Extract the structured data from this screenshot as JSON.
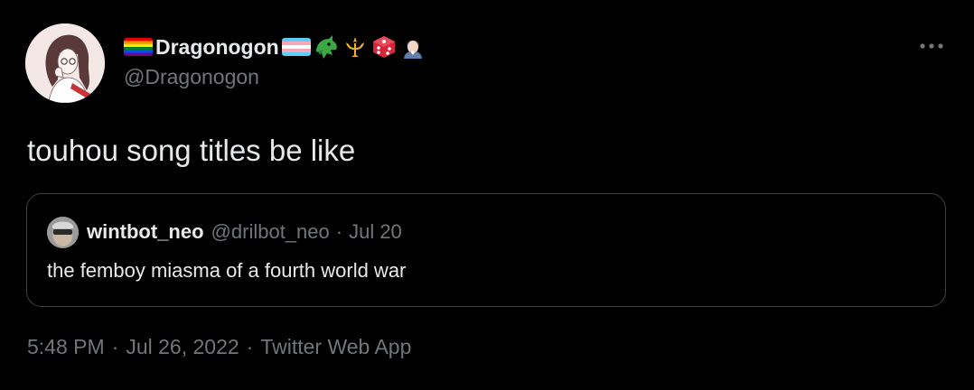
{
  "author": {
    "display_name": "Dragonogon",
    "handle": "@Dragonogon",
    "badges": [
      "rainbow-flag",
      "transgender-flag",
      "dragon-face",
      "trident-emblem",
      "game-die",
      "person-icon"
    ]
  },
  "tweet": {
    "text": "touhou song titles be like"
  },
  "quote": {
    "display_name": "wintbot_neo",
    "handle": "@drilbot_neo",
    "separator": "·",
    "date": "Jul 20",
    "text": "the femboy miasma of a fourth world war"
  },
  "meta": {
    "time": "5:48 PM",
    "separator": "·",
    "date": "Jul 26, 2022",
    "source": "Twitter Web App"
  },
  "more_icon": "more-horizontal-icon",
  "colors": {
    "background": "#000000",
    "text_primary": "#e7e9ea",
    "text_secondary": "#71767b",
    "border": "#3e4144"
  }
}
